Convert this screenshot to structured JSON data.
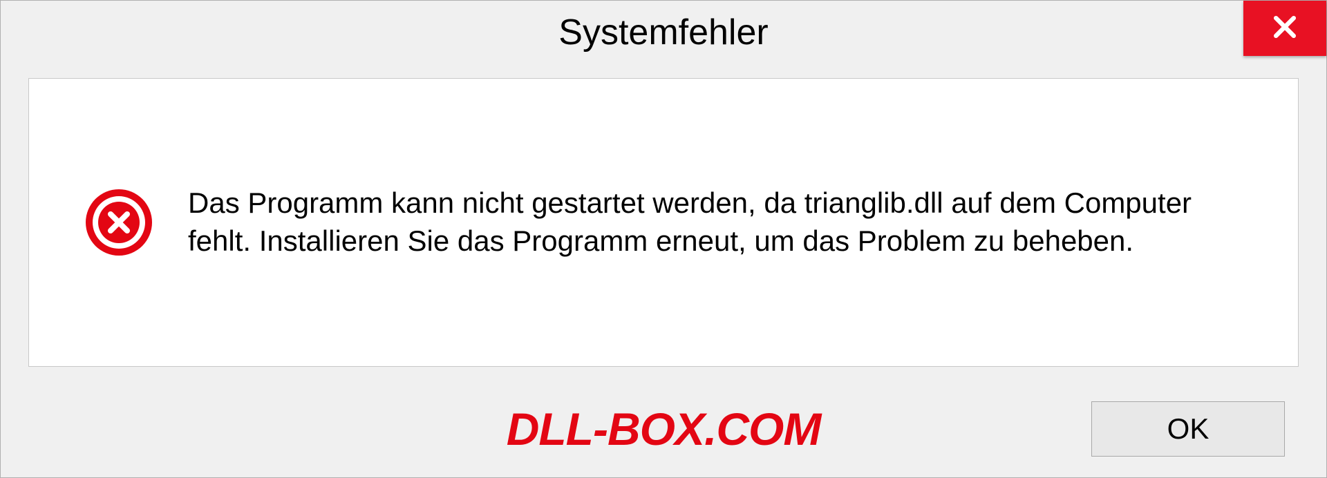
{
  "dialog": {
    "title": "Systemfehler",
    "message": "Das Programm kann nicht gestartet werden, da trianglib.dll auf dem Computer fehlt. Installieren Sie das Programm erneut, um das Problem zu beheben.",
    "ok_label": "OK"
  },
  "watermark": "DLL-BOX.COM"
}
